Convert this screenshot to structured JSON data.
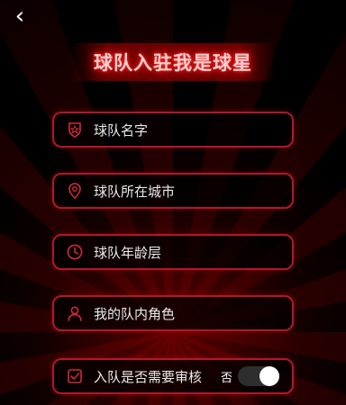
{
  "header": {
    "back_icon": "chevron-left-icon",
    "title": "球队入驻我是球星"
  },
  "form": {
    "fields": [
      {
        "label": "球队名字",
        "icon": "team-badge-icon"
      },
      {
        "label": "球队所在城市",
        "icon": "location-pin-icon"
      },
      {
        "label": "球队年龄层",
        "icon": "clock-icon"
      },
      {
        "label": "我的队内角色",
        "icon": "user-icon"
      },
      {
        "label": "入队是否需要审核",
        "icon": "checkbox-icon",
        "toggle_label": "否",
        "toggle_on": false
      }
    ]
  },
  "colors": {
    "accent": "#b0182a",
    "title_glow": "#ff0000",
    "background": "#000000"
  }
}
